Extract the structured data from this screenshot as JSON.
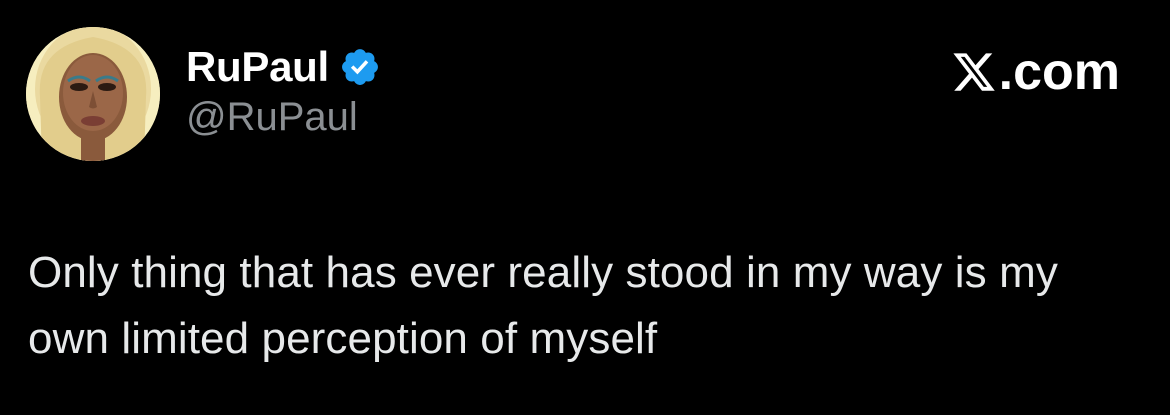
{
  "tweet": {
    "author": {
      "display_name": "RuPaul",
      "handle": "@RuPaul",
      "verified": true,
      "avatar_icon": "avatar-portrait"
    },
    "site_label": ".com",
    "site_icon": "x-logo-icon",
    "text": "Only thing that has ever really stood in my way is my own limited perception of myself"
  },
  "colors": {
    "background": "#000000",
    "name": "#ffffff",
    "handle": "#8b8f93",
    "text": "#e7e9ea",
    "verified_badge": "#1d9bf0"
  }
}
